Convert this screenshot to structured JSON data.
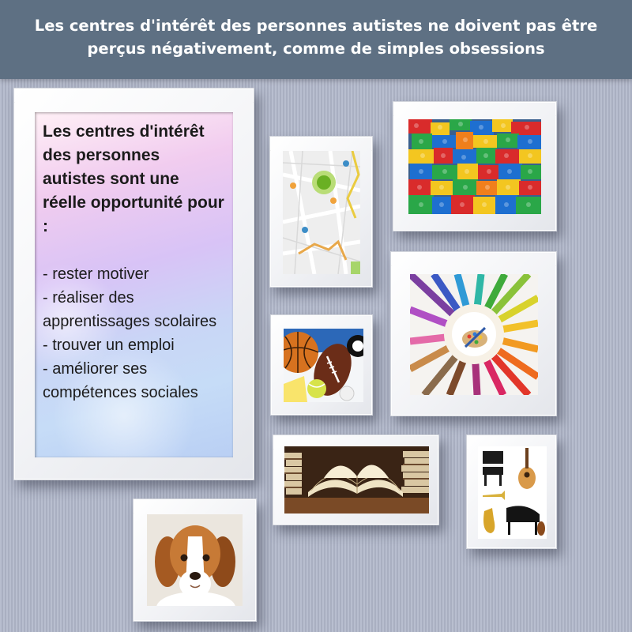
{
  "header": {
    "title": "Les centres d'intérêt des personnes autistes ne doivent pas être perçus négativement, comme de simples obsessions"
  },
  "panel": {
    "heading": "Les centres d'intérêt des personnes autistes sont une réelle opportunité pour :",
    "items": [
      "- rester motiver",
      "- réaliser des apprentissages scolaires",
      "- trouver un emploi",
      "- améliorer ses compétences sociales"
    ]
  },
  "pictures": [
    {
      "subject": "map-photo"
    },
    {
      "subject": "lego-bricks-photo"
    },
    {
      "subject": "colored-pencils-photo"
    },
    {
      "subject": "sports-balls-photo"
    },
    {
      "subject": "open-books-photo"
    },
    {
      "subject": "musical-instruments-photo"
    },
    {
      "subject": "beagle-puppy-photo"
    }
  ],
  "colors": {
    "header_bg": "#5e7083",
    "wall": "#b4bacb",
    "frame": "#ffffff"
  }
}
